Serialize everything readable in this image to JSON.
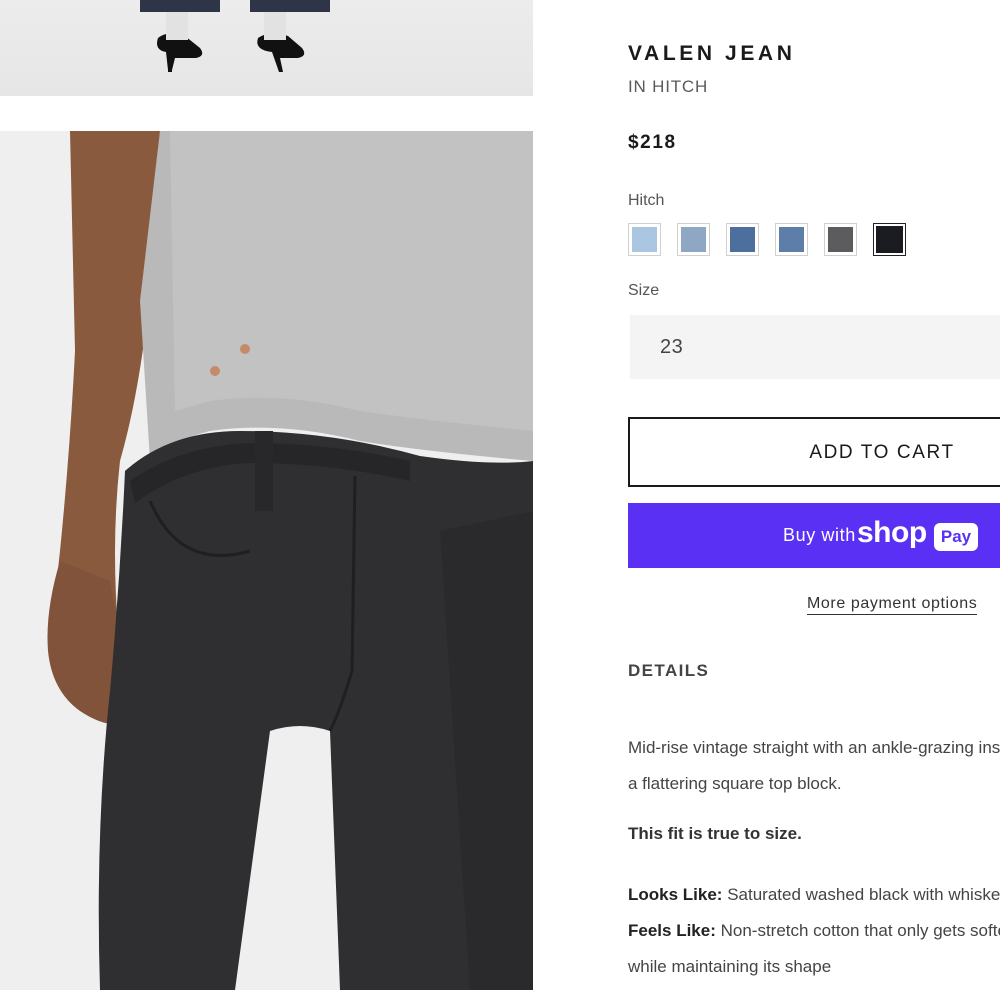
{
  "product": {
    "title": "VALEN JEAN",
    "color_name": "IN HITCH",
    "price": "$218"
  },
  "color_selector": {
    "label": "Hitch",
    "swatches": [
      {
        "name": "light-blue",
        "color": "#aac6e0"
      },
      {
        "name": "mid-light-blue",
        "color": "#8ea7c2"
      },
      {
        "name": "medium-blue",
        "color": "#4d6f9e"
      },
      {
        "name": "blue",
        "color": "#5d7ea8"
      },
      {
        "name": "grey",
        "color": "#5c5c5f"
      },
      {
        "name": "black",
        "color": "#1a1c21",
        "selected": true
      }
    ]
  },
  "size_selector": {
    "label": "Size",
    "value": "23"
  },
  "actions": {
    "add_to_cart": "ADD TO CART",
    "shop_pay_prefix": "Buy with",
    "shop_pay_wordmark": "shop",
    "shop_pay_badge": "Pay",
    "more_payment": "More payment options"
  },
  "details": {
    "heading": "DETAILS",
    "description_line_1": "Mid-rise vintage straight with an ankle-grazing inseam and",
    "description_line_2": "a flattering square top block.",
    "fit_note": "This fit is true to size.",
    "looks_like_label": "Looks Like:",
    "looks_like_value": " Saturated washed black with whiskering",
    "feels_like_label": "Feels Like:",
    "feels_like_value": " Non-stretch cotton that only gets softer with wear",
    "feels_like_value_2": "while maintaining its shape"
  },
  "colors": {
    "shop_pay_purple": "#5a31f4",
    "text_dark": "#1a1a1a",
    "text_muted": "#5a5a5a"
  }
}
